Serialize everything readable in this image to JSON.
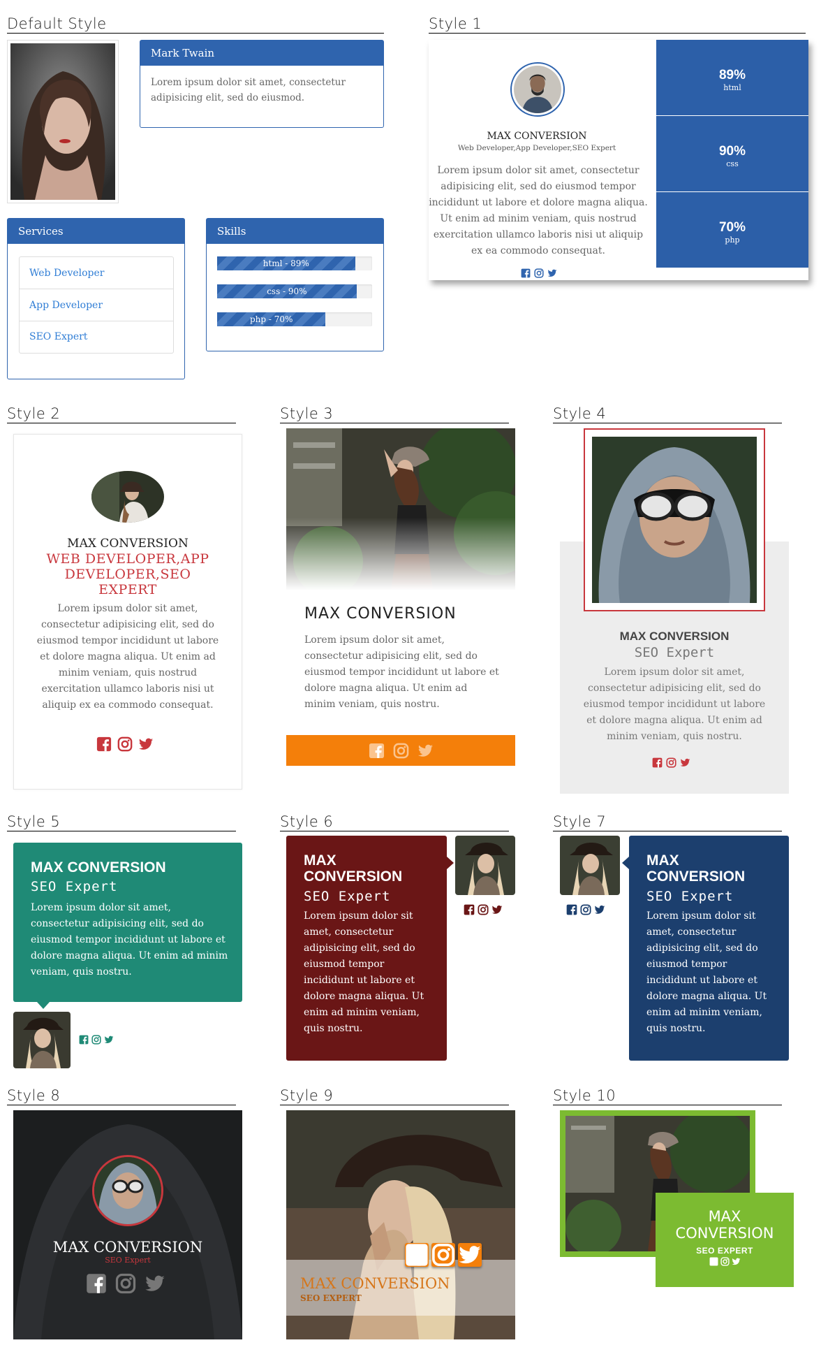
{
  "sections": {
    "default": "Default Style",
    "s1": "Style 1",
    "s2": "Style 2",
    "s3": "Style 3",
    "s4": "Style 4",
    "s5": "Style 5",
    "s6": "Style 6",
    "s7": "Style 7",
    "s8": "Style 8",
    "s9": "Style 9",
    "s10": "Style 10"
  },
  "default_style": {
    "panel_title": "Mark Twain",
    "panel_body": "Lorem ipsum dolor sit amet, consectetur adipisicing elit, sed do eiusmod.",
    "services_title": "Services",
    "services": [
      "Web Developer",
      "App Developer",
      "SEO Expert"
    ],
    "skills_title": "Skills",
    "skills": [
      {
        "label": "html - 89%",
        "value": 89
      },
      {
        "label": "css - 90%",
        "value": 90
      },
      {
        "label": "php - 70%",
        "value": 70
      }
    ]
  },
  "style1": {
    "name": "MAX CONVERSION",
    "role": "Web Developer,App Developer,SEO Expert",
    "text": "Lorem ipsum dolor sit amet, consectetur adipisicing elit, sed do eiusmod tempor incididunt ut labore et dolore magna aliqua. Ut enim ad minim veniam, quis nostrud exercitation ullamco laboris nisi ut aliquip ex ea commodo consequat.",
    "stats": [
      {
        "value": "89%",
        "label": "html"
      },
      {
        "value": "90%",
        "label": "css"
      },
      {
        "value": "70%",
        "label": "php"
      }
    ]
  },
  "style2": {
    "name": "MAX CONVERSION",
    "role": "WEB DEVELOPER,APP DEVELOPER,SEO EXPERT",
    "text": "Lorem ipsum dolor sit amet, consectetur adipisicing elit, sed do eiusmod tempor incididunt ut labore et dolore magna aliqua. Ut enim ad minim veniam, quis nostrud exercitation ullamco laboris nisi ut aliquip ex ea commodo consequat."
  },
  "style3": {
    "name": "MAX CONVERSION",
    "text": "Lorem ipsum dolor sit amet, consectetur adipisicing elit, sed do eiusmod tempor incididunt ut labore et dolore magna aliqua. Ut enim ad minim veniam, quis nostru."
  },
  "style4": {
    "name": "MAX CONVERSION",
    "role": "SEO Expert",
    "text": "Lorem ipsum dolor sit amet, consectetur adipisicing elit, sed do eiusmod tempor incididunt ut labore et dolore magna aliqua. Ut enim ad minim veniam, quis nostru."
  },
  "style5": {
    "name": "MAX CONVERSION",
    "role": "SEO Expert",
    "text": "Lorem ipsum dolor sit amet, consectetur adipisicing elit, sed do eiusmod tempor incididunt ut labore et dolore magna aliqua. Ut enim ad minim veniam, quis nostru."
  },
  "style6": {
    "name": "MAX CONVERSION",
    "role": "SEO Expert",
    "text": "Lorem ipsum dolor sit amet, consectetur adipisicing elit, sed do eiusmod tempor incididunt ut labore et dolore magna aliqua. Ut enim ad minim veniam, quis nostru."
  },
  "style7": {
    "name": "MAX CONVERSION",
    "role": "SEO Expert",
    "text": "Lorem ipsum dolor sit amet, consectetur adipisicing elit, sed do eiusmod tempor incididunt ut labore et dolore magna aliqua. Ut enim ad minim veniam, quis nostru."
  },
  "style8": {
    "name": "MAX CONVERSION",
    "role": "SEO Expert"
  },
  "style9": {
    "name": "MAX CONVERSION",
    "role": "SEO EXPERT"
  },
  "style10": {
    "name": "MAX CONVERSION",
    "role": "SEO EXPERT"
  },
  "colors": {
    "blue": "#2f64ae",
    "red": "#c8373d",
    "orange": "#f47f0a",
    "teal": "#1f8a76",
    "maroon": "#6a1616",
    "navy": "#1c3f6e",
    "green": "#7cbb31"
  },
  "icons": [
    "facebook-icon",
    "instagram-icon",
    "twitter-icon"
  ]
}
